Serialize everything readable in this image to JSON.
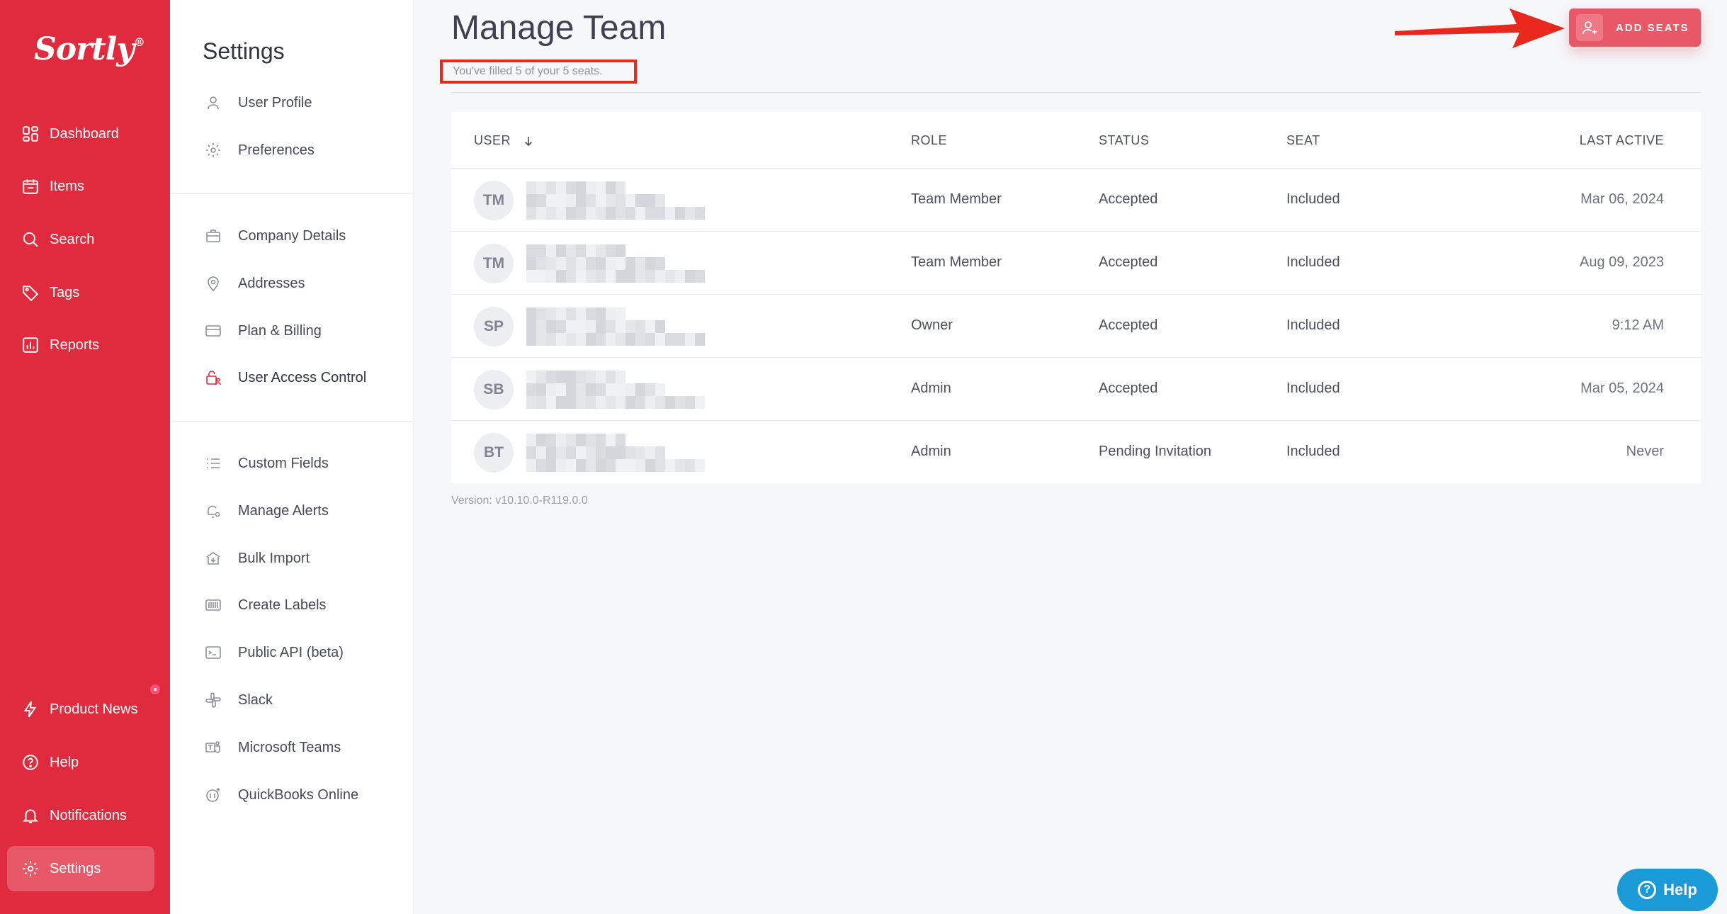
{
  "brand": {
    "logo_text": "Sortly",
    "registered": "®"
  },
  "nav": {
    "items": [
      {
        "label": "Dashboard",
        "icon": "dashboard-icon"
      },
      {
        "label": "Items",
        "icon": "items-icon"
      },
      {
        "label": "Search",
        "icon": "search-icon"
      },
      {
        "label": "Tags",
        "icon": "tag-icon"
      },
      {
        "label": "Reports",
        "icon": "reports-icon"
      }
    ],
    "bottom": [
      {
        "label": "Product News",
        "icon": "lightning-icon"
      },
      {
        "label": "Help",
        "icon": "help-icon"
      },
      {
        "label": "Notifications",
        "icon": "bell-icon"
      },
      {
        "label": "Settings",
        "icon": "gear-icon",
        "active": true
      }
    ]
  },
  "settings": {
    "title": "Settings",
    "group1": [
      {
        "label": "User Profile",
        "icon": "user-icon"
      },
      {
        "label": "Preferences",
        "icon": "gear-icon"
      }
    ],
    "group2": [
      {
        "label": "Company Details",
        "icon": "briefcase-icon"
      },
      {
        "label": "Addresses",
        "icon": "location-pin-icon"
      },
      {
        "label": "Plan & Billing",
        "icon": "credit-card-icon"
      },
      {
        "label": "User Access Control",
        "icon": "lock-user-icon",
        "active": true
      }
    ],
    "group3": [
      {
        "label": "Custom Fields",
        "icon": "list-icon"
      },
      {
        "label": "Manage Alerts",
        "icon": "bell-gear-icon"
      },
      {
        "label": "Bulk Import",
        "icon": "import-icon"
      },
      {
        "label": "Create Labels",
        "icon": "barcode-icon"
      },
      {
        "label": "Public API (beta)",
        "icon": "terminal-icon"
      },
      {
        "label": "Slack",
        "icon": "slack-icon"
      },
      {
        "label": "Microsoft Teams",
        "icon": "teams-icon"
      },
      {
        "label": "QuickBooks Online",
        "icon": "quickbooks-icon"
      }
    ]
  },
  "main": {
    "title": "Manage Team",
    "seat_note": "You've filled 5 of your 5 seats.",
    "add_seats_label": "ADD SEATS",
    "columns": {
      "user": "USER",
      "role": "ROLE",
      "status": "STATUS",
      "seat": "SEAT",
      "last_active": "LAST ACTIVE"
    },
    "rows": [
      {
        "initials": "TM",
        "role": "Team Member",
        "status": "Accepted",
        "seat": "Included",
        "last_active": "Mar 06, 2024"
      },
      {
        "initials": "TM",
        "role": "Team Member",
        "status": "Accepted",
        "seat": "Included",
        "last_active": "Aug 09, 2023"
      },
      {
        "initials": "SP",
        "role": "Owner",
        "status": "Accepted",
        "seat": "Included",
        "last_active": "9:12 AM"
      },
      {
        "initials": "SB",
        "role": "Admin",
        "status": "Accepted",
        "seat": "Included",
        "last_active": "Mar 05, 2024"
      },
      {
        "initials": "BT",
        "role": "Admin",
        "status": "Pending Invitation",
        "seat": "Included",
        "last_active": "Never"
      }
    ],
    "version": "Version: v10.10.0-R119.0.0"
  },
  "help_button": {
    "label": "Help"
  },
  "colors": {
    "brand_red": "#e02b3f",
    "annotation_red": "#e8281c",
    "help_blue": "#1a9ad7"
  }
}
